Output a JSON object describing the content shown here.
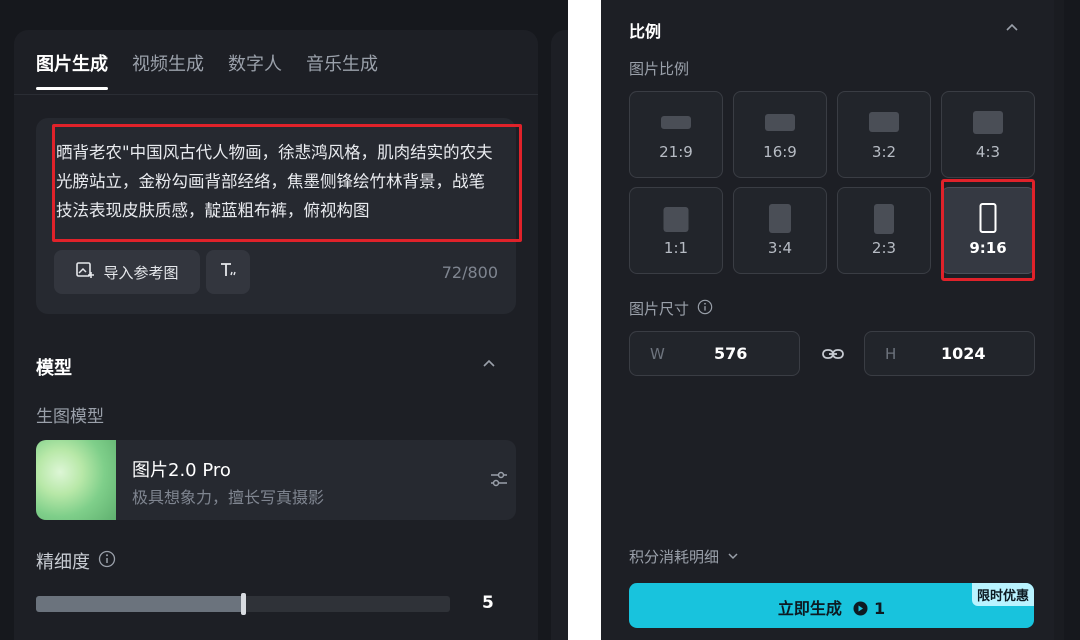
{
  "left": {
    "tabs": [
      {
        "label": "图片生成",
        "active": true
      },
      {
        "label": "视频生成",
        "active": false
      },
      {
        "label": "数字人",
        "active": false
      },
      {
        "label": "音乐生成",
        "active": false
      }
    ],
    "prompt": {
      "text": "晒背老农\"中国风古代人物画，徐悲鸿风格，肌肉结实的农夫光膀站立，金粉勾画背部经络，焦墨侧锋绘竹林背景，战笔技法表现皮肤质感，靛蓝粗布裤，俯视构图",
      "import_ref_label": "导入参考图",
      "char_count": "72/800"
    },
    "model_section": {
      "title": "模型",
      "sub_label": "生图模型",
      "model_name": "图片2.0 Pro",
      "model_desc": "极具想象力，擅长写真摄影"
    },
    "detail": {
      "title": "精细度",
      "value": "5",
      "level": 0.5
    }
  },
  "right": {
    "ratio_section": {
      "title": "比例",
      "sub_label": "图片比例",
      "ratios": [
        {
          "label": "21:9",
          "selected": false
        },
        {
          "label": "16:9",
          "selected": false
        },
        {
          "label": "3:2",
          "selected": false
        },
        {
          "label": "4:3",
          "selected": false
        },
        {
          "label": "1:1",
          "selected": false
        },
        {
          "label": "3:4",
          "selected": false
        },
        {
          "label": "2:3",
          "selected": false
        },
        {
          "label": "9:16",
          "selected": true
        }
      ]
    },
    "size": {
      "title": "图片尺寸",
      "w_prefix": "W",
      "w_value": "576",
      "h_prefix": "H",
      "h_value": "1024"
    },
    "credit_detail_label": "积分消耗明细",
    "generate": {
      "label": "立即生成",
      "cost": "1",
      "promo_badge": "限时优惠",
      "color": "#18c3dd"
    }
  }
}
